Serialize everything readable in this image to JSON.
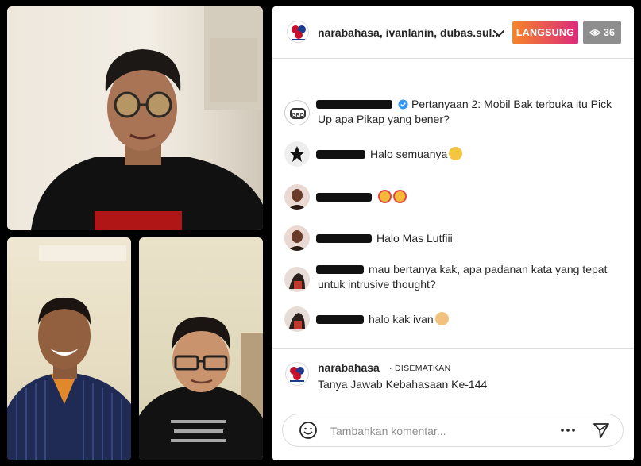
{
  "header": {
    "title": "narabahasa, ivanlanin, dubas.sul...",
    "live_label": "LANGSUNG",
    "viewer_count": "36",
    "live_gradient": [
      "#f58529",
      "#dd2a7b"
    ]
  },
  "comments": [
    {
      "user_redacted": true,
      "verified": true,
      "text": "Pertanyaan 2: Mobil Bak terbuka itu Pick Up apa Pikap yang bener?"
    },
    {
      "user_redacted": true,
      "text": "Halo semuanya",
      "emoji": [
        "raising-hands"
      ]
    },
    {
      "user_redacted": true,
      "text": "",
      "emoji": [
        "star-struck",
        "star-struck"
      ]
    },
    {
      "user_redacted": true,
      "text": "Halo Mas Lutfiii"
    },
    {
      "user_redacted": true,
      "text": "mau bertanya kak, apa padanan kata yang tepat untuk intrusive thought?"
    },
    {
      "user_redacted": true,
      "text": "halo kak ivan",
      "emoji": [
        "clapping-hands"
      ]
    }
  ],
  "pinned": {
    "username": "narabahasa",
    "tag": "· DISEMATKAN",
    "text": "Tanya Jawab Kebahasaan Ke-144"
  },
  "composer": {
    "placeholder": "Tambahkan komentar..."
  }
}
